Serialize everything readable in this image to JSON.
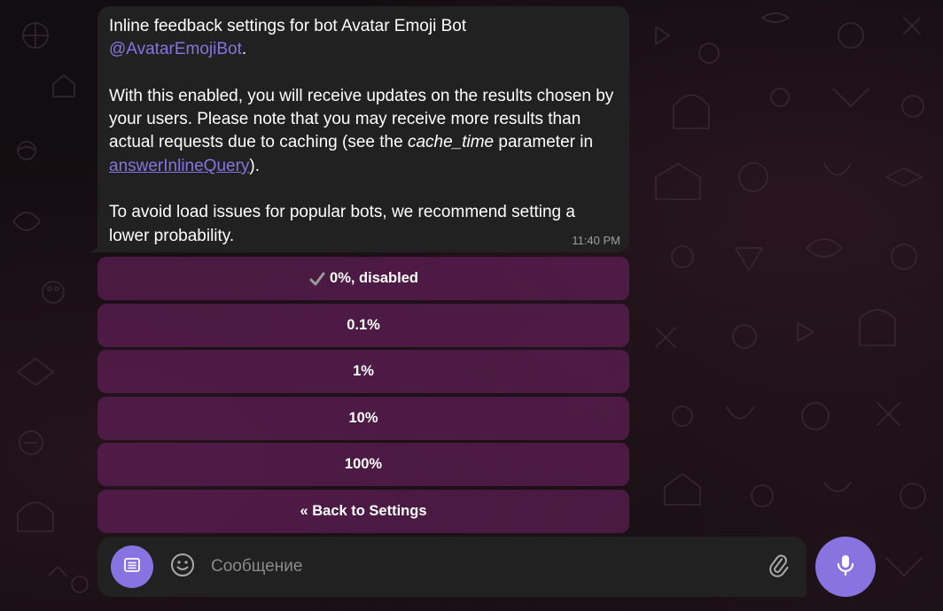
{
  "message": {
    "line1_text": "Inline feedback settings for bot Avatar Emoji Bot",
    "mention": "@AvatarEmojiBot",
    "mention_suffix": ".",
    "p2_before_code": "With this enabled, you will receive updates on the results chosen by your users. Please note that you may receive more results than actual requests due to caching (see the ",
    "p2_code": "cache_time",
    "p2_after_code": " parameter in ",
    "p2_link": "answerInlineQuery",
    "p2_end": ").",
    "p3": "To avoid load issues for popular bots, we recommend setting a lower probability.",
    "time": "11:40 PM"
  },
  "keyboard": {
    "buttons": [
      {
        "label": "0%, disabled",
        "selected": true,
        "icon": "check-mark-icon"
      },
      {
        "label": "0.1%"
      },
      {
        "label": "1%"
      },
      {
        "label": "10%"
      },
      {
        "label": "100%"
      },
      {
        "label": "« Back to Settings"
      }
    ]
  },
  "composer": {
    "placeholder": "Сообщение",
    "value": "",
    "icons": [
      "menu-icon",
      "emoji-icon",
      "attach-icon",
      "mic-icon"
    ]
  },
  "colors": {
    "accent": "#8774e1",
    "bubble": "#212121",
    "keyboard_button": "#5c2358",
    "background": "#120d10"
  }
}
